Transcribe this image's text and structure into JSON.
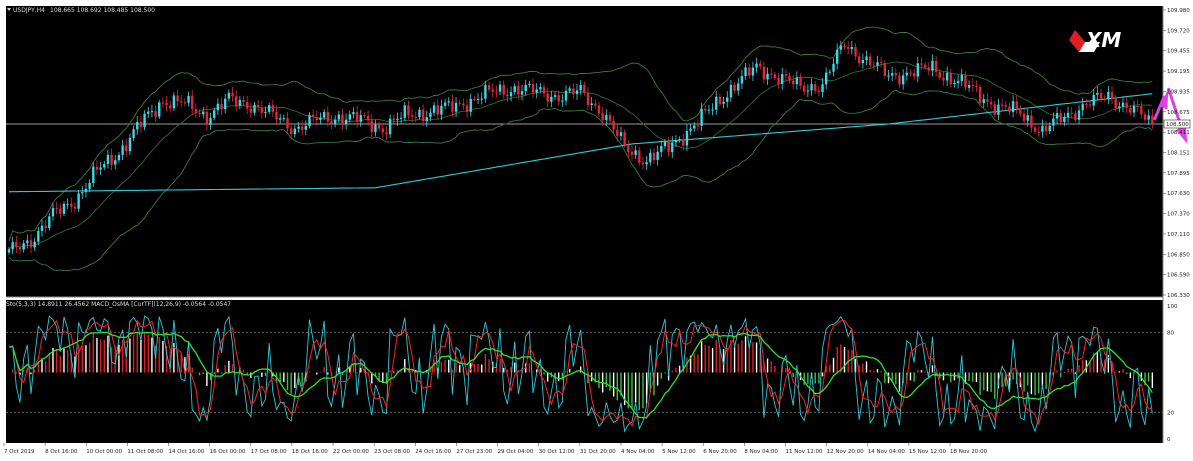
{
  "header": {
    "symbol_info": "USDJPY,H4",
    "ohlc": "108.665 108.692 108.485 108.500"
  },
  "indicator_header": "Sto(5,3,3) 14.8911 26.4562  MACD_OsMA [CurTF](12,26,9) -0.0564 -0.0547",
  "logo_text": "XM",
  "price_axis": {
    "labels": [
      "109.980",
      "109.720",
      "109.455",
      "109.195",
      "108.935",
      "108.675",
      "108.411",
      "108.151",
      "107.895",
      "107.630",
      "107.370",
      "107.110",
      "106.850",
      "106.590",
      "106.330"
    ],
    "current_price": "108.500"
  },
  "osc_axis": {
    "labels": [
      "100",
      "80",
      "20",
      "0"
    ]
  },
  "time_axis": {
    "labels": [
      "7 Oct 2019",
      "8 Oct 16:00",
      "10 Oct 00:00",
      "11 Oct 08:00",
      "14 Oct 16:00",
      "16 Oct 00:00",
      "17 Oct 08:00",
      "18 Oct 16:00",
      "22 Oct 00:00",
      "23 Oct 08:00",
      "24 Oct 16:00",
      "27 Oct 23:00",
      "29 Oct 04:00",
      "30 Oct 12:00",
      "31 Oct 20:00",
      "4 Nov 04:00",
      "5 Nov 12:00",
      "6 Nov 20:00",
      "8 Nov 04:00",
      "11 Nov 12:00",
      "12 Nov 20:00",
      "14 Nov 04:00",
      "15 Nov 12:00",
      "18 Nov 20:00"
    ]
  },
  "chart_data": {
    "type": "candlestick",
    "title": "",
    "xlabel": "",
    "ylabel": "",
    "ylim": [
      106.33,
      109.98
    ],
    "x_range": [
      "7 Oct 2019",
      "18 Nov 20:00"
    ],
    "close_path_anchors": [
      [
        0,
        106.88
      ],
      [
        6,
        107.05
      ],
      [
        12,
        107.35
      ],
      [
        18,
        107.55
      ],
      [
        24,
        107.9
      ],
      [
        30,
        108.15
      ],
      [
        36,
        108.5
      ],
      [
        42,
        108.8
      ],
      [
        48,
        108.75
      ],
      [
        54,
        108.6
      ],
      [
        60,
        108.8
      ],
      [
        66,
        108.75
      ],
      [
        72,
        108.6
      ],
      [
        78,
        108.45
      ],
      [
        84,
        108.55
      ],
      [
        90,
        108.6
      ],
      [
        96,
        108.55
      ],
      [
        102,
        108.45
      ],
      [
        108,
        108.6
      ],
      [
        114,
        108.65
      ],
      [
        120,
        108.7
      ],
      [
        126,
        108.8
      ],
      [
        132,
        108.9
      ],
      [
        138,
        108.95
      ],
      [
        144,
        108.9
      ],
      [
        150,
        108.85
      ],
      [
        156,
        108.9
      ],
      [
        162,
        108.65
      ],
      [
        168,
        108.2
      ],
      [
        174,
        108.05
      ],
      [
        180,
        108.2
      ],
      [
        186,
        108.45
      ],
      [
        192,
        108.7
      ],
      [
        198,
        109.0
      ],
      [
        204,
        109.2
      ],
      [
        210,
        109.1
      ],
      [
        216,
        108.95
      ],
      [
        222,
        109.0
      ],
      [
        228,
        109.5
      ],
      [
        234,
        109.3
      ],
      [
        240,
        109.1
      ],
      [
        246,
        109.15
      ],
      [
        252,
        109.2
      ],
      [
        258,
        109.05
      ],
      [
        264,
        108.9
      ],
      [
        270,
        108.7
      ],
      [
        276,
        108.65
      ],
      [
        282,
        108.4
      ],
      [
        288,
        108.6
      ],
      [
        294,
        108.75
      ],
      [
        300,
        108.85
      ],
      [
        306,
        108.7
      ],
      [
        312,
        108.5
      ]
    ],
    "moving_average_slow": [
      [
        0,
        107.65
      ],
      [
        100,
        107.7
      ],
      [
        170,
        108.25
      ],
      [
        240,
        108.5
      ],
      [
        312,
        108.88
      ]
    ],
    "signal_arrows": [
      {
        "direction": "up",
        "color": "#e040e0"
      },
      {
        "direction": "down",
        "color": "#e040e0"
      }
    ],
    "indicators": [
      "Stochastic(5,3,3)",
      "MACD OsMA (12,26,9)"
    ],
    "oscillator_levels": [
      80,
      20
    ],
    "colors": {
      "bull": "#3fd6e6",
      "bear": "#e0283c",
      "ma": "#2fc9d6",
      "bands": "#3a7a3a",
      "stoch_main": "#2fc9d6",
      "stoch_signal": "#ff2020",
      "hist_pos": "#e02020",
      "hist_neg": "#40c040",
      "green_line": "#30e030",
      "arrow": "#e040e0"
    }
  }
}
